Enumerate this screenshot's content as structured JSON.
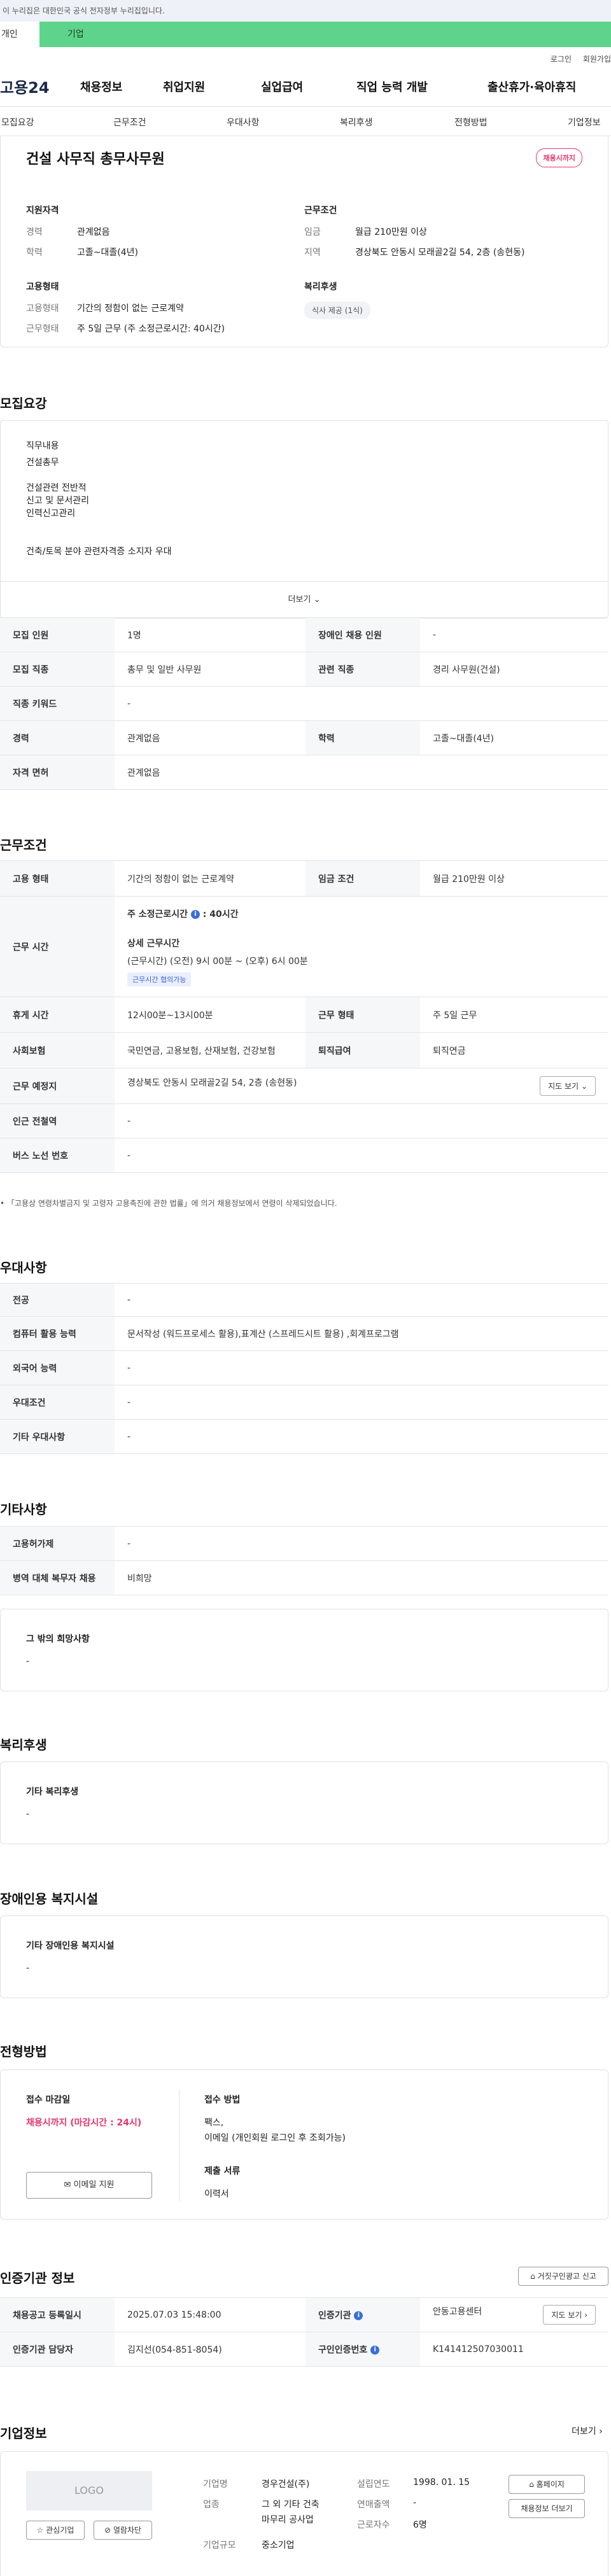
{
  "gov_notice": "이 누리집은 대한민국 공식 전자정부 누리집입니다.",
  "who_tabs": [
    "개인",
    "기업"
  ],
  "util": {
    "login": "로그인",
    "join": "회원가입"
  },
  "gnb": {
    "logo": "고용24",
    "menu": [
      "채용정보",
      "취업지원",
      "실업급여",
      "직업 능력 개발",
      "출산휴가·육아휴직"
    ]
  },
  "subnav": [
    "모집요강",
    "근무조건",
    "우대사항",
    "복리후생",
    "전형방법",
    "기업정보"
  ],
  "job": {
    "title": "건설 사무직 총무사무원",
    "status": "채용시까지",
    "qual_title": "지원자격",
    "qual": [
      {
        "k": "경력",
        "v": "관계없음"
      },
      {
        "k": "학력",
        "v": "고졸~대졸(4년)"
      }
    ],
    "emp_title": "고용형태",
    "emp": [
      {
        "k": "고용형태",
        "v": "기간의 정함이 없는 근로계약"
      },
      {
        "k": "근무형태",
        "v": "주 5일 근무 (주 소정근로시간: 40시간)"
      }
    ],
    "cond_title": "근무조건",
    "cond": [
      {
        "k": "임금",
        "v": "월급 210만원 이상"
      },
      {
        "k": "지역",
        "v": "경상북도 안동시 모래골2길 54, 2층 (송현동)"
      }
    ],
    "welfare_title": "복리후생",
    "welfare_tag": "식사 제공 (1식)"
  },
  "recruit": {
    "heading": "모집요강",
    "lines": [
      "직무내용",
      "건설총무",
      "",
      "건설관련 전반적",
      "신고 및 문서관리",
      "인력신고관리",
      "",
      "",
      "건축/토목 분야 관련자격증 소지자 우대"
    ],
    "more": "더보기"
  },
  "recruit_table": [
    [
      "모집 인원",
      "1명",
      "장애인 채용 인원",
      "-"
    ],
    [
      "모집 직종",
      "총무 및 일반 사무원",
      "관련 직종",
      "경리 사무원(건설)"
    ],
    [
      "직종 키워드",
      "-"
    ],
    [
      "경력",
      "관계없음",
      "학력",
      "고졸~대졸(4년)"
    ],
    [
      "자격 면허",
      "관계없음"
    ]
  ],
  "work": {
    "heading": "근무조건",
    "emp_type_k": "고용 형태",
    "emp_type_v": "기간의 정함이 없는 근로계약",
    "wage_k": "임금 조건",
    "wage_v": "월급 210만원 이상",
    "hours_k": "근무 시간",
    "hours_week": "주 소정근로시간",
    "hours_week_v": ": 40시간",
    "hours_detail_t": "상세 근무시간",
    "hours_detail": "(근무시간) (오전) 9시 00분 ~ (오후) 6시 00분",
    "hours_tag": "근무시간 협의가능",
    "break_k": "휴게 시간",
    "break_v": "12시00분~13시00분",
    "form_k": "근무 형태",
    "form_v": "주 5일 근무",
    "ins_k": "사회보험",
    "ins_v": "국민연금, 고용보험, 산재보험, 건강보험",
    "ret_k": "퇴직급여",
    "ret_v": "퇴직연금",
    "place_k": "근무 예정지",
    "place_v": "경상북도 안동시 모래골2길 54, 2층 (송현동)",
    "map_btn": "지도 보기",
    "subway_k": "인근 전철역",
    "subway_v": "-",
    "bus_k": "버스 노선 번호",
    "bus_v": "-",
    "note": "「고용상 연령차별금지 및 고령자 고용촉진에 관한 법률」에 의거 채용정보에서 연령이 삭제되었습니다."
  },
  "pref": {
    "heading": "우대사항",
    "rows": [
      [
        "전공",
        "-"
      ],
      [
        "컴퓨터 활용 능력",
        "문서작성 (워드프로세스 활용),표계산 (스프레드시트 활용) ,회계프로그램"
      ],
      [
        "외국어 능력",
        "-"
      ],
      [
        "우대조건",
        "-"
      ],
      [
        "기타 우대사항",
        "-"
      ]
    ]
  },
  "etc": {
    "heading": "기타사항",
    "rows": [
      [
        "고용허가제",
        "-"
      ],
      [
        "병역 대체 복무자 채용",
        "비희망"
      ]
    ],
    "box_title": "그 밖의 희망사항",
    "box_value": "-"
  },
  "welfare": {
    "heading": "복리후생",
    "box_title": "기타 복리후생",
    "box_value": "-"
  },
  "disabled": {
    "heading": "장애인용 복지시설",
    "box_title": "기타 장애인용 복지시설",
    "box_value": "-"
  },
  "selection": {
    "heading": "전형방법",
    "deadline_t": "접수 마감일",
    "deadline_v": "채용시까지 (마감시간 : 24시)",
    "email_btn": "이메일 지원",
    "method_t": "접수 방법",
    "method_v1": "팩스,",
    "method_v2": "이메일 (개인회원 로그인 후 조회가능)",
    "docs_t": "제출 서류",
    "docs_v": "이력서"
  },
  "agency": {
    "heading": "인증기관 정보",
    "report_btn": "거짓구인광고 신고",
    "reg_k": "채용공고 등록일시",
    "reg_v": "2025.07.03 15:48:00",
    "org_k": "인증기관",
    "org_v": "안동고용센터",
    "map_btn": "지도 보기",
    "mgr_k": "인증기관 담당자",
    "mgr_v": "김지선(054-851-8054)",
    "num_k": "구인인증번호",
    "num_v": "K141412507030011"
  },
  "company": {
    "heading": "기업정보",
    "more": "더보기",
    "logo": "LOGO",
    "fav_btn": "관심기업",
    "block_btn": "열람차단",
    "name_k": "기업명",
    "name_v": "경우건설(주)",
    "biz_k": "업종",
    "biz_v1": "그 외 기타 건축",
    "biz_v2": "마무리 공사업",
    "size_k": "기업규모",
    "size_v": "중소기업",
    "est_k": "설립연도",
    "est_v": "1998. 01. 15",
    "sales_k": "연매출액",
    "sales_v": "-",
    "emp_k": "근로자수",
    "emp_v": "6명",
    "home_btn": "홈페이지",
    "list_btn": "채용정보 더보기"
  }
}
